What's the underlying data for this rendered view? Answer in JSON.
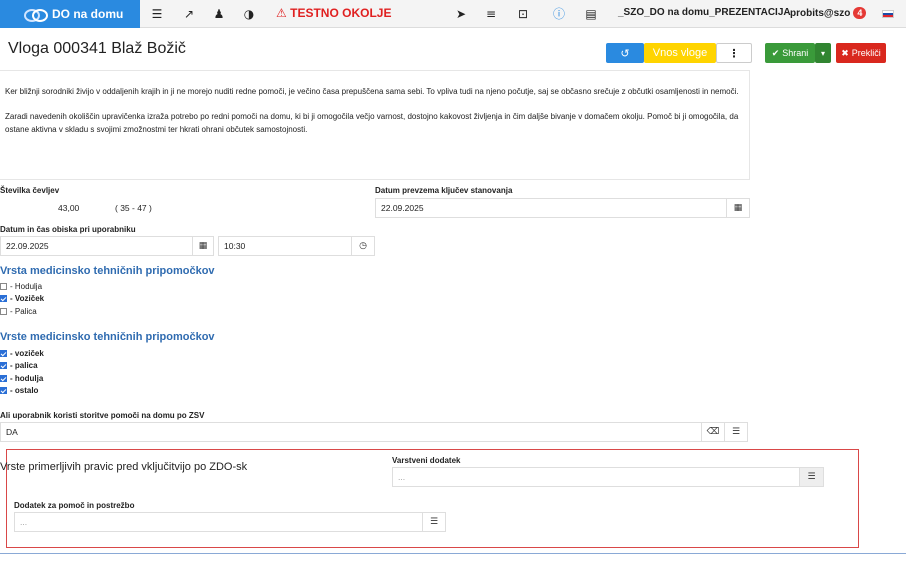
{
  "topbar": {
    "brand": "DO na domu",
    "testno": "TESTNO OKOLJE",
    "project": "_SZO_DO na domu_PREZENTACIJA",
    "user": "probits@szo",
    "notifications": "4",
    "icons": [
      "list-icon",
      "external-link-icon",
      "user-secret-icon",
      "contrast-icon",
      "warning-icon",
      "send-icon",
      "menu-icon",
      "remote-desktop-icon",
      "info-icon",
      "document-icon",
      "flag-icon"
    ]
  },
  "header": {
    "title": "Vloga 000341 Blaž Božič",
    "vnos_label": "Vnos vloge",
    "more_label": "⋮",
    "save_label": "Shrani",
    "cancel_label": "Prekliči"
  },
  "textblock": {
    "p1": "Ker bližnji sorodniki živijo v oddaljenih krajih in ji ne morejo nuditi redne pomoči, je večino časa prepuščena sama sebi. To vpliva tudi na njeno počutje, saj se občasno srečuje z občutki osamljenosti in nemoči.",
    "p2": "Zaradi navedenih okoliščin upravičenka izraža potrebo po redni pomoči na domu, ki bi ji omogočila večjo varnost, dostojno kakovost življenja in čim daljše bivanje v domačem okolju. Pomoč bi ji omogočila, da ostane aktivna v skladu s svojimi zmožnostmi ter hkrati ohrani občutek samostojnosti."
  },
  "form": {
    "shoe_label": "Številka čevljev",
    "shoe_value": "43,00",
    "shoe_range": "( 35 - 47 )",
    "keys_label": "Datum prevzema ključev stanovanja",
    "keys_value": "22.09.2025",
    "visit_label": "Datum in čas obiska pri uporabniku",
    "visit_date": "22.09.2025",
    "visit_time": "10:30",
    "section1_title": "Vrsta medicinsko tehničnih pripomočkov",
    "section1_items": [
      {
        "label": "- Hodulja",
        "checked": false
      },
      {
        "label": "- Voziček",
        "checked": true
      },
      {
        "label": "- Palica",
        "checked": false
      }
    ],
    "section2_title": "Vrste medicinsko tehničnih pripomočkov",
    "section2_items": [
      {
        "label": "- voziček",
        "checked": true
      },
      {
        "label": "- palica",
        "checked": true
      },
      {
        "label": "- hodulja",
        "checked": true
      },
      {
        "label": "- ostalo",
        "checked": true
      }
    ],
    "zsv_label": "Ali uporabnik koristi storitve pomoči na domu po ZSV",
    "zsv_value": "DA",
    "rights_title": "Vrste primerljivih pravic pred vključitvijo po ZDO-sk",
    "varstveni_label": "Varstveni dodatek",
    "varstveni_placeholder": "...",
    "dodatek_label": "Dodatek za pomoč in postrežbo",
    "dodatek_placeholder": "..."
  }
}
